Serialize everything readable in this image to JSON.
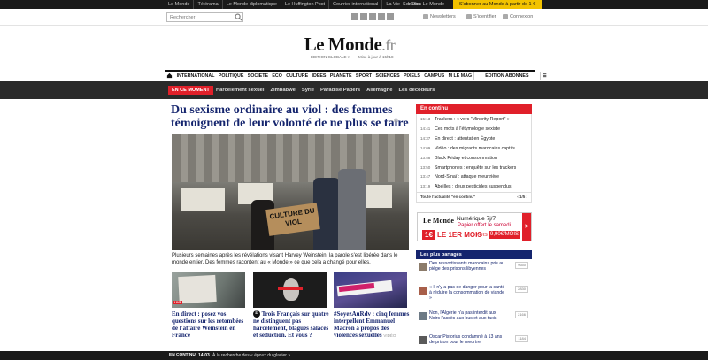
{
  "topbar": {
    "sites": [
      "Le Monde",
      "Télérama",
      "Le Monde diplomatique",
      "Le Huffington Post",
      "Courrier international",
      "La Vie",
      "L'Obs"
    ],
    "services": "Services Le Monde",
    "subscribe": "S'abonner au Monde à partir de 1 €"
  },
  "toolbar": {
    "search_placeholder": "Rechercher",
    "social": [
      "facebook-icon",
      "twitter-icon",
      "google-plus-icon",
      "youtube-icon",
      "rss-icon"
    ],
    "newsletters": "Newsletters",
    "identifier": "S'identifier",
    "connexion": "Connexion"
  },
  "header": {
    "logo_main": "Le Monde",
    "logo_suffix": ".fr",
    "edition": "ÉDITION GLOBALE",
    "updated": "Mise à jour à 15h18"
  },
  "nav": {
    "items": [
      "INTERNATIONAL",
      "POLITIQUE",
      "SOCIÉTÉ",
      "ÉCO",
      "CULTURE",
      "IDÉES",
      "PLANÈTE",
      "SPORT",
      "SCIENCES",
      "PIXELS",
      "CAMPUS",
      "M LE MAG"
    ],
    "subscriber_edition": "ÉDITION ABONNÉS"
  },
  "moment": {
    "label": "EN CE MOMENT",
    "links": [
      "Harcèlement sexuel",
      "Zimbabwe",
      "Syrie",
      "Paradise Papers",
      "Allemagne",
      "Les décodeurs"
    ]
  },
  "main": {
    "headline": "Du sexisme ordinaire au viol : des femmes témoignent de leur volonté de ne plus se taire",
    "comments": "94",
    "sign_text": "CULTURE DU VIOL",
    "summary": "Plusieurs semaines après les révélations visant Harvey Weinstein, la parole s'est libérée dans le monde entier. Des femmes racontent au « Monde » ce que cela a changé pour elles."
  },
  "sub_articles": [
    {
      "title": "En direct : posez vos questions sur les retombées de l'affaire Weinstein en France",
      "tag": "LIVE"
    },
    {
      "title": "Trois Français sur quatre ne distinguent pas harcèlement, blagues salaces et séduction. Et vous ?",
      "tag": "D"
    },
    {
      "title": "#SoyezAuRdv : cinq femmes interpellent Emmanuel Macron à propos des violences sexuelles",
      "tag": "VIDÉO"
    }
  ],
  "en_continu": {
    "title": "En continu",
    "items": [
      {
        "time": "15:13",
        "text": "Trackers : « vers \"Minority Report\" »"
      },
      {
        "time": "14:41",
        "text": "Ces mots à l'étymologie sexiste"
      },
      {
        "time": "14:37",
        "text": "En direct : attentat en Égypte"
      },
      {
        "time": "14:09",
        "text": "Vidéo : des migrants marocains captifs"
      },
      {
        "time": "13:58",
        "text": "Black Friday et consommation"
      },
      {
        "time": "13:50",
        "text": "Smartphones : enquête sur les trackers"
      },
      {
        "time": "13:47",
        "text": "Nord-Sinaï : attaque meurtrière"
      },
      {
        "time": "13:19",
        "text": "Abeilles : deux pesticides suspendus"
      }
    ],
    "footer_link": "Toute l'actualité \"en continu\"",
    "pager": "1/5"
  },
  "ad": {
    "brand": "Le Monde",
    "numerique": "Numérique 7j/7",
    "offer": "Papier offert le samedi",
    "one_euro": "1€",
    "first_month": "LE 1ER MOIS",
    "puis": "PUIS",
    "price": "9,90€/MOIS",
    "cta": ">"
  },
  "partages": {
    "title": "Les plus partagés",
    "items": [
      {
        "text": "Des ressortissants marocains pris au piège des prisons libyennes",
        "count": "9650"
      },
      {
        "text": "« Il n'y a pas de danger pour la santé à réduire la consommation de viande »",
        "count": "2830"
      },
      {
        "text": "Non, l'Algérie n'a pas interdit aux Noirs l'accès aux bus et aux taxis",
        "count": "2166"
      },
      {
        "text": "Oscar Pistorius condamné à 13 ans de prison pour le meurtre",
        "count": "1184"
      }
    ]
  },
  "bottom": {
    "label": "EN CONTINU",
    "time": "14:03",
    "text": "À la recherche des « époux du glacier »"
  }
}
